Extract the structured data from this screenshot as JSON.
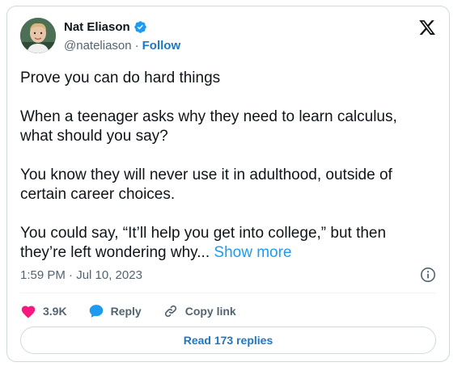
{
  "author": {
    "display_name": "Nat Eliason",
    "handle": "@nateliason",
    "separator": "·",
    "follow_label": "Follow"
  },
  "tweet": {
    "paragraphs": [
      "Prove you can do hard things",
      "When a teenager asks why they need to learn calculus, what should you say?",
      "You know they will never use it in adulthood, outside of certain career choices.",
      "You could say, “It’ll help you get into college,” but then they’re left wondering why..."
    ],
    "show_more_label": "Show more",
    "timestamp": "1:59 PM · Jul 10, 2023"
  },
  "actions": {
    "like_count": "3.9K",
    "reply_label": "Reply",
    "copy_link_label": "Copy link"
  },
  "read_replies_label": "Read 173 replies",
  "colors": {
    "accent_blue": "#1d9bf0",
    "link_blue": "#1d77c7",
    "heart_red": "#f91880",
    "reply_blue": "#1d9bf0",
    "secondary_text": "#536471",
    "border": "#cfd9de"
  },
  "icons": {
    "verified": "verified-badge-icon",
    "brand": "x-logo-icon",
    "info": "info-icon",
    "like": "heart-icon",
    "reply": "speech-bubble-icon",
    "copy_link": "link-icon"
  }
}
